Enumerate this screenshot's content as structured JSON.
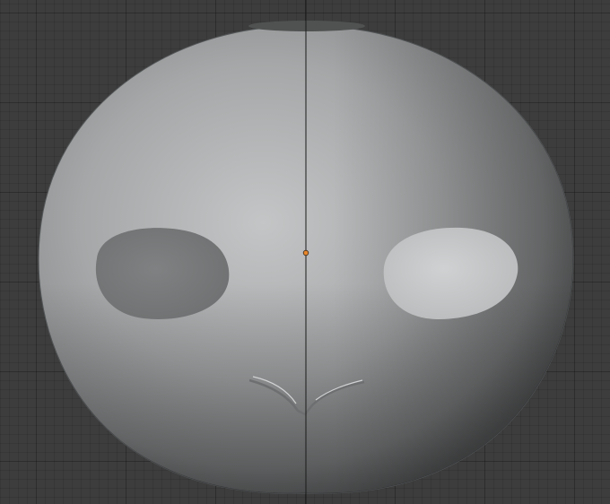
{
  "viewport": {
    "object": "mask-mesh",
    "shading": "solid",
    "background_color": "#3d3d3d",
    "grid_color": "#333333",
    "mesh_color": "#a9abac",
    "origin_color": "#e8872b",
    "icons": [
      "origin-point-icon"
    ]
  }
}
